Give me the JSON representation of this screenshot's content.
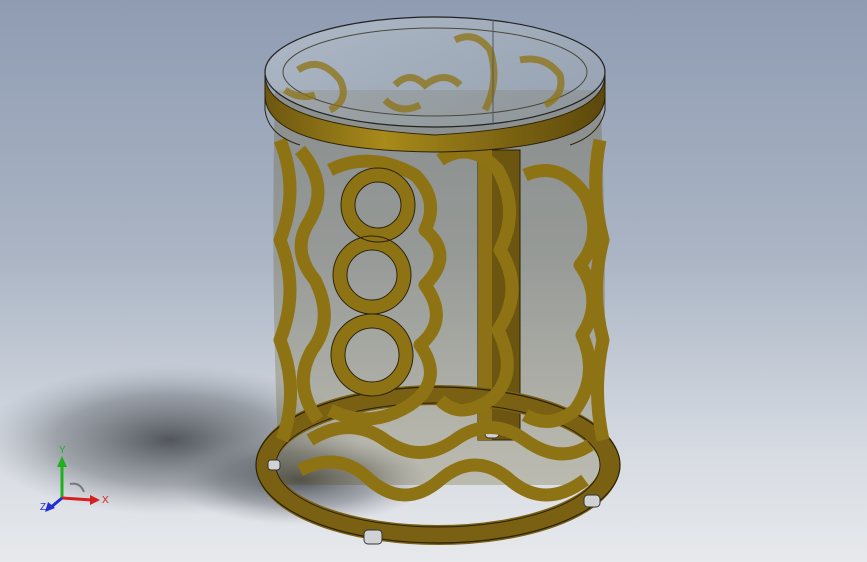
{
  "viewport": {
    "background_top": "#8f9cb2",
    "background_bottom": "#e7e9ec"
  },
  "model": {
    "description_icon": "cad-model",
    "frame_color": "#8a6e12",
    "frame_highlight": "#b08f1c",
    "glass_color": "#a8b4bf"
  },
  "triad": {
    "x_label": "X",
    "y_label": "Y",
    "z_label": "Z",
    "x_color": "#d42020",
    "y_color": "#1fb01f",
    "z_color": "#2030d0"
  }
}
